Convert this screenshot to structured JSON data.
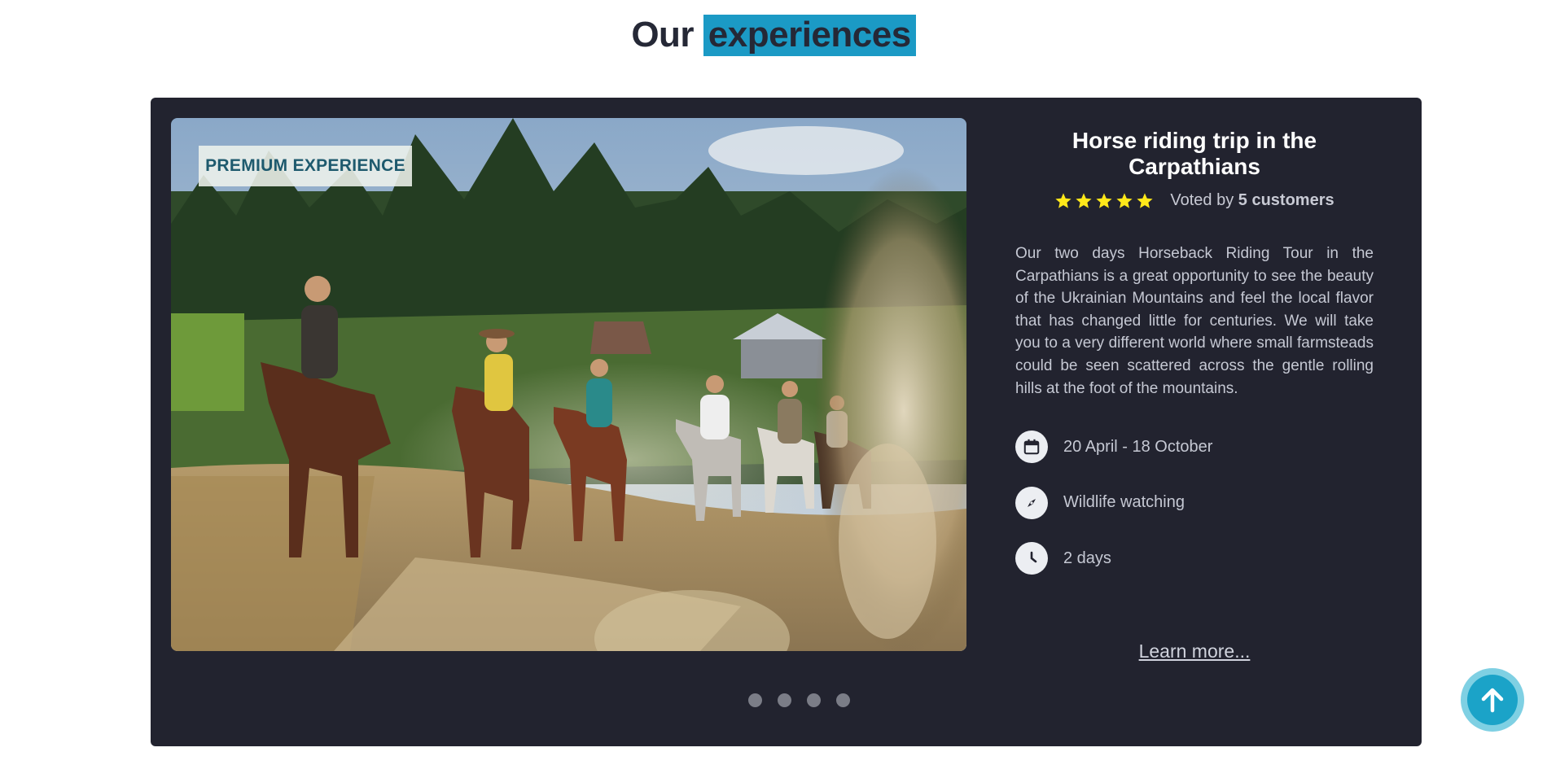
{
  "section": {
    "title_plain": "Our",
    "title_highlight": "experiences",
    "highlight_color": "#1b9ac5"
  },
  "slide": {
    "badge": "PREMIUM EXPERIENCE",
    "image_icon": "horse-riding-photo",
    "title": "Horse riding trip in the Carpathians",
    "rating": {
      "stars": 5,
      "star_color": "#ffe81a",
      "voted_prefix": "Voted by",
      "voted_count": "5 customers"
    },
    "description": "Our two days Horseback Riding Tour in the Carpathians is a great opportunity to see the beauty of the Ukrainian Mountains and feel the local flavor that has changed little for centuries. We will take you to a very different world where small farmsteads could be seen scattered across the gentle rolling hills at the foot of the mountains.",
    "facts": [
      {
        "icon": "calendar-icon",
        "text": "20 April - 18 October"
      },
      {
        "icon": "compass-icon",
        "text": "Wildlife watching"
      },
      {
        "icon": "clock-icon",
        "text": "2 days"
      }
    ],
    "learn_more": "Learn more..."
  },
  "carousel": {
    "dot_count": 4
  },
  "colors": {
    "card_bg": "#22232f",
    "scroll_top_button": "#1ba3c8"
  },
  "scroll_top": {
    "icon": "arrow-up-icon"
  }
}
